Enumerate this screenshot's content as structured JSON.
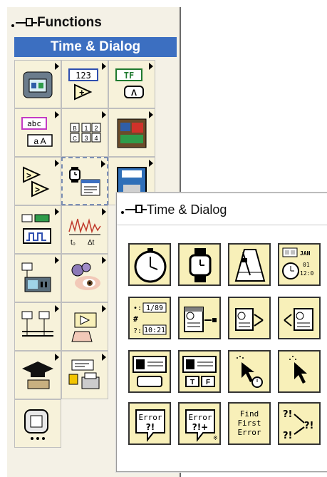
{
  "main_palette": {
    "title": "Functions",
    "subpalette_label": "Time & Dialog",
    "icon_labels": {
      "numeric_badge": "123",
      "boolean_badge": "TF",
      "string_badge": "abc",
      "array_cells": [
        "B",
        "1",
        "2",
        "C",
        "3",
        "4"
      ],
      "time_labels": [
        "t₀",
        "Δt"
      ]
    }
  },
  "time_dialog_palette": {
    "title": "Time & Dialog",
    "tiles": [
      {
        "name": "tick-count"
      },
      {
        "name": "wait-ms"
      },
      {
        "name": "wait-until-next-ms-multiple"
      },
      {
        "name": "get-date-time-string",
        "label": "JAN 01 12:00"
      },
      {
        "name": "seconds-to-date-time",
        "label": "1/89 10:21"
      },
      {
        "name": "date-time-to-seconds"
      },
      {
        "name": "get-date-time-in-seconds"
      },
      {
        "name": "format-date-time"
      },
      {
        "name": "one-button-dialog"
      },
      {
        "name": "two-button-dialog",
        "label": "T F"
      },
      {
        "name": "three-button-dialog"
      },
      {
        "name": "user-dialog"
      },
      {
        "name": "simple-error-handler",
        "label": "Error ?!"
      },
      {
        "name": "general-error-handler",
        "label": "Error ?!+"
      },
      {
        "name": "find-first-error",
        "label": "Find First Error"
      },
      {
        "name": "merge-errors",
        "label": "?!"
      }
    ]
  }
}
